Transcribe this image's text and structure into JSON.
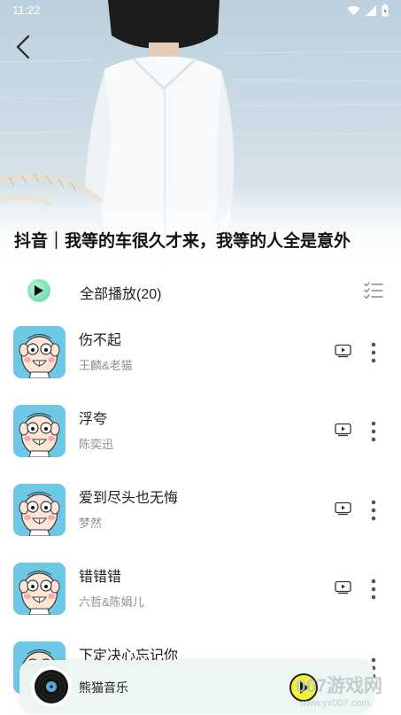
{
  "status_bar": {
    "time": "11:22"
  },
  "header": {
    "playlist_title": "抖音｜我等的车很久才来，我等的人全是意外"
  },
  "play_all": {
    "label": "全部播放(20)"
  },
  "songs": [
    {
      "title": "伤不起",
      "artist": "王麟&老猫"
    },
    {
      "title": "浮夸",
      "artist": "陈奕迅"
    },
    {
      "title": "爱到尽头也无悔",
      "artist": "梦然"
    },
    {
      "title": "错错错",
      "artist": "六哲&陈娟儿"
    },
    {
      "title": "下定决心忘记你",
      "artist": ""
    }
  ],
  "mini_player": {
    "title": "熊猫音乐"
  },
  "watermark": {
    "text": "007游戏网",
    "url": "www.yx007.com"
  },
  "colors": {
    "accent_green": "#7fe0b4",
    "play_yellow": "#f2f230",
    "artist_gray": "#8f8f8f"
  }
}
